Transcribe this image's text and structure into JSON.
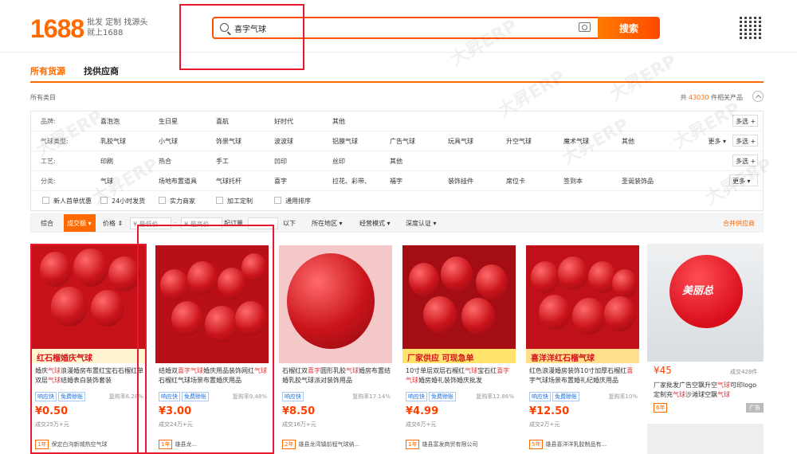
{
  "header": {
    "logo": "1688",
    "slogan_line1": "批发 定制 找源头",
    "slogan_line2": "就上1688",
    "search_value": "喜字气球",
    "search_button": "搜索"
  },
  "tabs": [
    {
      "label": "所有货源"
    },
    {
      "label": "找供应商"
    }
  ],
  "breadcrumb": "所有类目",
  "total": {
    "prefix": "共",
    "count": "43030",
    "suffix": "件相关产品"
  },
  "filters": {
    "brand": {
      "label": "品牌:",
      "options": [
        "喜泡泡",
        "生日星",
        "喜航",
        "好时代",
        "其他"
      ],
      "multi": "多选"
    },
    "type": {
      "label": "气球类型:",
      "options": [
        "乳胶气球",
        "小气球",
        "饰景气球",
        "波波球",
        "铝膜气球",
        "广告气球",
        "玩具气球",
        "升空气球",
        "魔术气球",
        "其他"
      ],
      "more": "更多",
      "multi": "多选"
    },
    "craft": {
      "label": "工艺:",
      "options": [
        "印刷",
        "热合",
        "手工",
        "凹印",
        "丝印",
        "其他"
      ],
      "multi": "多选"
    },
    "category": {
      "label": "分类:",
      "options": [
        "气球",
        "场地布置道具",
        "气球托杆",
        "喜字",
        "拉花、彩带、",
        "福字",
        "装饰挂件",
        "席位卡",
        "签到本",
        "圣诞装饰品"
      ],
      "more": "更多"
    },
    "checks": [
      "新人首单优惠",
      "24小时发货",
      "实力商家",
      "加工定制",
      "通用排序"
    ]
  },
  "sort_bar": {
    "all": "综合",
    "active": "成交额",
    "price": "价格",
    "low": "¥ 最低价",
    "high": "¥ 最高价",
    "moq_label": "起订量",
    "moq_unit": "以下",
    "location": "所在地区",
    "mode": "经营模式",
    "cert": "深度认证",
    "merge": "合并供应商"
  },
  "products": [
    {
      "caption": "红石榴婚庆气球",
      "title_a": "婚庆",
      "title_hl1": "气球",
      "title_b": "浪漫婚房布置红宝石石榴红单双层",
      "title_hl2": "气球",
      "title_c": "结婚表白装饰套装",
      "tag1": "响应快",
      "tag2": "免费赊账",
      "rate": "复购率6.28%",
      "price": "¥0.50",
      "sales": "成交25万+元",
      "years": "1年",
      "shop": "保定白沟新城热空气球"
    },
    {
      "caption": "",
      "title_a": "结婚双",
      "title_hl1": "喜字气球",
      "title_b": "婚庆用品装饰网红",
      "title_hl2": "气球",
      "title_c": "石榴红气球场景布置婚庆用品",
      "tag1": "响应快",
      "tag2": "免费赊账",
      "rate": "复购率9.48%",
      "price": "¥3.00",
      "sales": "成交24万+元",
      "years": "1年",
      "shop": "雄县龙..."
    },
    {
      "caption": "",
      "title_a": "石榴红双",
      "title_hl1": "喜字",
      "title_b": "圆形乳胶",
      "title_hl2": "气球",
      "title_c": "婚房布置结婚乳胶气球派对装饰用品",
      "tag1": "响应快",
      "tag2": "",
      "rate": "复购率17.14%",
      "price": "¥8.50",
      "sales": "成交16万+元",
      "years": "2年",
      "shop": "雄县龙湾镇前程气球纳..."
    },
    {
      "caption": "厂家供应 可现急单",
      "title_a": "10寸单层双层石榴红",
      "title_hl1": "气球",
      "title_b": "宝石红",
      "title_hl2": "喜字气球",
      "title_c": "婚房婚礼装饰婚庆批发",
      "tag1": "响应快",
      "tag2": "免费赊账",
      "rate": "复购率12.86%",
      "price": "¥4.99",
      "sales": "成交6万+元",
      "years": "1年",
      "shop": "雄县富发商贸有限公司"
    },
    {
      "caption": "喜洋洋红石榴气球",
      "title_a": "红色浪漫婚房装饰10寸加厚石榴红",
      "title_hl1": "喜",
      "title_b": "字气球场景布置婚礼纪婚庆用品",
      "title_hl2": "",
      "title_c": "",
      "tag1": "响应快",
      "tag2": "免费赊账",
      "rate": "复购率10%",
      "price": "¥12.50",
      "sales": "成交2万+元",
      "years": "5年",
      "shop": "雄县喜洋洋乳胶制品有..."
    }
  ],
  "side_ad": {
    "logo_text": "美丽总",
    "price": "¥45",
    "sales": "成交428件",
    "title_a": "厂家批发广告空飘升空",
    "title_hl1": "气球",
    "title_b": "可印logo定制充",
    "title_hl2": "气球",
    "title_c": "沙滩球空飘",
    "title_hl3": "气球",
    "years": "6年",
    "ad": "广告"
  },
  "watermark": "大昇ERP"
}
